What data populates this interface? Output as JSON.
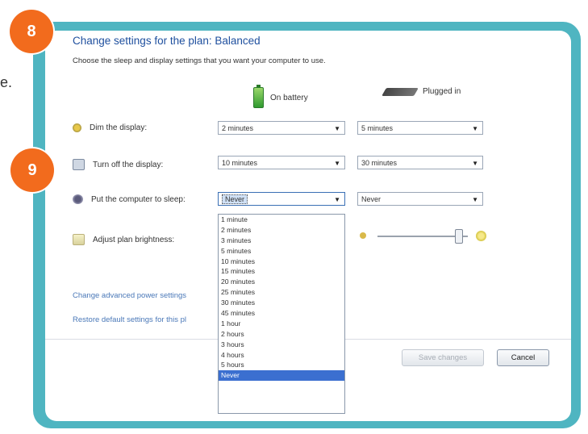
{
  "stray_text": "e.",
  "badges": {
    "step_8": "8",
    "step_9": "9"
  },
  "header": {
    "title": "Change settings for the plan: Balanced",
    "subtitle": "Choose the sleep and display settings that you want your computer to use."
  },
  "columns": {
    "battery": "On battery",
    "plugged": "Plugged in"
  },
  "rows": {
    "dim": {
      "label": "Dim the display:",
      "battery": "2 minutes",
      "plugged": "5 minutes"
    },
    "off": {
      "label": "Turn off the display:",
      "battery": "10 minutes",
      "plugged": "30 minutes"
    },
    "sleep": {
      "label": "Put the computer to sleep:",
      "battery": "Never",
      "plugged": "Never"
    },
    "brightness": {
      "label": "Adjust plan brightness:"
    }
  },
  "sleep_options": [
    "1 minute",
    "2 minutes",
    "3 minutes",
    "5 minutes",
    "10 minutes",
    "15 minutes",
    "20 minutes",
    "25 minutes",
    "30 minutes",
    "45 minutes",
    "1 hour",
    "2 hours",
    "3 hours",
    "4 hours",
    "5 hours",
    "Never"
  ],
  "links": {
    "advanced": "Change advanced power settings",
    "restore": "Restore default settings for this pl"
  },
  "buttons": {
    "save": "Save changes",
    "cancel": "Cancel"
  },
  "colors": {
    "frame": "#4fb5c1",
    "badge": "#f26b1d",
    "title": "#1e4f9e",
    "selected": "#3b6fd0"
  }
}
